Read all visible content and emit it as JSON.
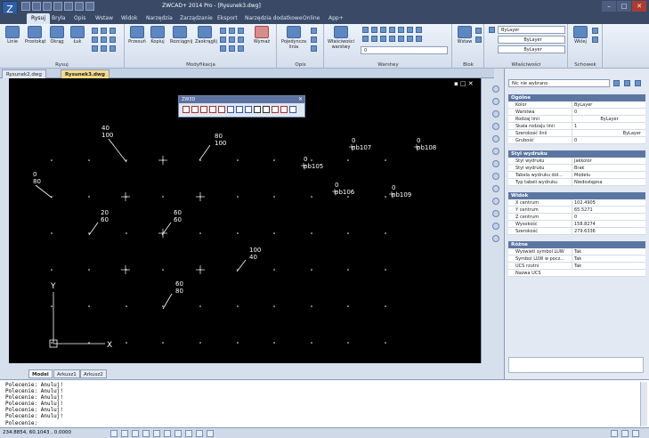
{
  "title": "ZWCAD+ 2014 Pro - [Rysunek3.dwg]",
  "menu": [
    "Rysuj",
    "Bryła",
    "Opis",
    "Wstaw",
    "Widok",
    "Narzędzia",
    "Zarządzanie",
    "Eksport",
    "Narzędzia dodatkowe",
    "Online",
    "App+"
  ],
  "ribbon": {
    "rysuj_buttons": [
      "Linie",
      "Prostokąt",
      "Okrąg",
      "Łuk"
    ],
    "modyfikacja_buttons": [
      "Przesuń",
      "Kopiuj",
      "Rozciągnij",
      "Zaokrąglij",
      "Wymaż"
    ],
    "opis_buttons": [
      "Pojedyncza linia"
    ],
    "warstwy_buttons": [
      "Właściwości warstwy"
    ],
    "blok_buttons": [
      "Wstaw"
    ],
    "schowek_buttons": [
      "Wklej"
    ],
    "layer_value": "0",
    "color_value": "ByLayer",
    "linetype_value": "ByLayer",
    "lineweight_value": "ByLayer",
    "groups": [
      "Rysuj",
      "Modyfikacja",
      "Opis",
      "Warstwy",
      "Blok",
      "Właściwości",
      "Schowek"
    ]
  },
  "doctabs": [
    "Rysunek2.dwg",
    "Rysunek3.dwg"
  ],
  "layouttabs": [
    "Model",
    "Arkusz1",
    "Arkusz2"
  ],
  "floating_toolbar_title": "ZW3D",
  "canvas_labels": [
    {
      "top": "40",
      "bottom": "100"
    },
    {
      "top": "80",
      "bottom": "100"
    },
    {
      "top": "0",
      "bottom": "80"
    },
    {
      "top": "20",
      "bottom": "60"
    },
    {
      "top": "60",
      "bottom": "60"
    },
    {
      "top": "100",
      "bottom": "40"
    },
    {
      "top": "60",
      "bottom": "80"
    },
    {
      "top": "0",
      "bottom": "pb107"
    },
    {
      "top": "0",
      "bottom": "pb108"
    },
    {
      "top": "0",
      "bottom": "pb105"
    },
    {
      "top": "0",
      "bottom": "pb106"
    },
    {
      "top": "0",
      "bottom": "pb109"
    }
  ],
  "axis": {
    "x": "X",
    "y": "Y"
  },
  "properties": {
    "selection": "Nic nie wybrano",
    "sections": [
      {
        "title": "Ogólne",
        "rows": [
          [
            "Kolor",
            "ByLayer"
          ],
          [
            "Warstwa",
            "0"
          ],
          [
            "Rodzaj linii",
            "ByLayer"
          ],
          [
            "Skala rodzaju linii",
            "1"
          ],
          [
            "Szerokość linii",
            "ByLayer"
          ],
          [
            "Grubość",
            "0"
          ]
        ]
      },
      {
        "title": "Styl wydruku",
        "rows": [
          [
            "Styl wydruku",
            "Jakkolor"
          ],
          [
            "Styl wydruku",
            "Brak"
          ],
          [
            "Tabela wydruku dol...",
            "Modelu"
          ],
          [
            "Typ tabeli wydruku",
            "Niedostępna"
          ]
        ]
      },
      {
        "title": "Widok",
        "rows": [
          [
            "X centrum",
            "102.4905"
          ],
          [
            "Y centrum",
            "65.5271"
          ],
          [
            "Z centrum",
            "0"
          ],
          [
            "Wysokość",
            "158.8274"
          ],
          [
            "Szerokość",
            "279.6336"
          ]
        ]
      },
      {
        "title": "Różne",
        "rows": [
          [
            "Wyświetl symbol LUW",
            "Tak"
          ],
          [
            "Symbol LUW w pocz...",
            "Tak"
          ],
          [
            "UCS rzutni",
            "Tak"
          ],
          [
            "Nazwa UCS",
            ""
          ]
        ]
      }
    ]
  },
  "command_history": [
    "Polecenie: Anuluj!",
    "Polecenie: Anuluj!",
    "Polecenie: Anuluj!",
    "Polecenie: Anuluj!",
    "Polecenie: Anuluj!",
    "Polecenie: Anuluj!"
  ],
  "command_prompt": "Polecenie:",
  "coordinates": "234.8854, 60.1043 , 0.0000"
}
